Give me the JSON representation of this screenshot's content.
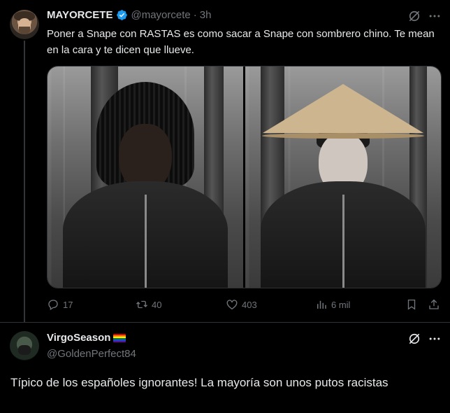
{
  "colors": {
    "background": "#000000",
    "text": "#e7e9ea",
    "muted": "#71767b",
    "divider": "#2f3336",
    "verified": "#1d9bf0"
  },
  "tweet1": {
    "author_name": "MAYORCETE",
    "handle": "@mayorcete",
    "separator": "·",
    "time": "3h",
    "verified": true,
    "text": "Poner a Snape con RASTAS es como sacar a Snape con sombrero chino. Te mean en la cara y te dicen que llueve.",
    "media": [
      {
        "icon": "photo-man-dreadlocks"
      },
      {
        "icon": "photo-man-conical-hat"
      }
    ],
    "actions": {
      "replies": "17",
      "reposts": "40",
      "likes": "403",
      "views": "6 mil"
    }
  },
  "tweet2": {
    "author_name": "VirgoSeason",
    "name_emoji": "rainbow-flag-icon",
    "handle": "@GoldenPerfect84",
    "text": "Típico de los españoles ignorantes! La mayoría son unos putos racistas"
  }
}
